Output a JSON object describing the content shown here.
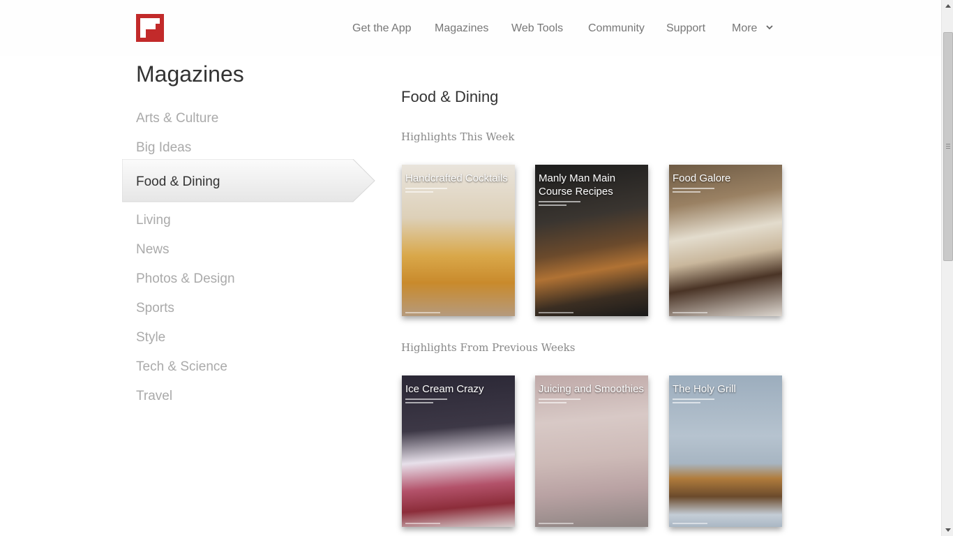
{
  "header": {
    "nav": [
      "Get the App",
      "Magazines",
      "Web Tools",
      "Community",
      "Support",
      "More"
    ]
  },
  "sidebar": {
    "title": "Magazines",
    "categories": [
      "Arts & Culture",
      "Big Ideas",
      "Food & Dining",
      "Living",
      "News",
      "Photos & Design",
      "Sports",
      "Style",
      "Tech & Science",
      "Travel"
    ],
    "active": "Food & Dining"
  },
  "main": {
    "title": "Food & Dining",
    "this_week_label": "Highlights This Week",
    "previous_label": "Highlights From Previous Weeks",
    "this_week": [
      {
        "title": "Handcrafted Cocktails"
      },
      {
        "title": "Manly Man Main Course Recipes"
      },
      {
        "title": "Food Galore"
      }
    ],
    "previous": [
      {
        "title": "Ice Cream Crazy"
      },
      {
        "title": "Juicing and Smoothies"
      },
      {
        "title": "The Holy Grill"
      }
    ]
  },
  "colors": {
    "brand": "#c22a2a",
    "nav_text": "#777777",
    "category_inactive": "#aaaaaa"
  }
}
